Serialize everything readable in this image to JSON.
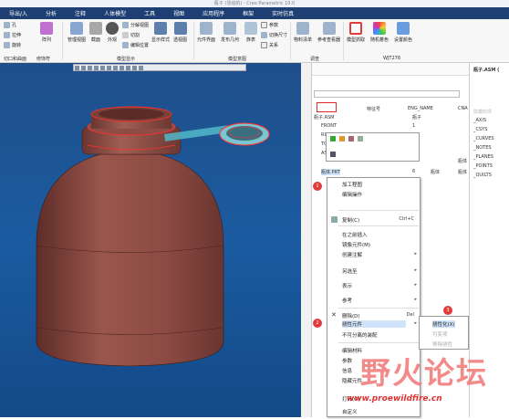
{
  "window": {
    "title": "瓶子 (活动的) - Creo Parametric 10.0"
  },
  "menu": [
    "导出/入",
    "分析",
    "注释",
    "人体模型",
    "工具",
    "视图",
    "应用程序",
    "框架",
    "实时仿真"
  ],
  "ribbon": {
    "small_left": [
      "孔",
      "拉伸",
      "旋转"
    ],
    "pattern": "阵列",
    "manage_view": "管理视图",
    "section": "截面",
    "appearance": "外观",
    "display_style": "显示样式",
    "small_mid": [
      "分解视图",
      "切割",
      "编辑位置"
    ],
    "reference": "透视图",
    "component_iface": "元件界面",
    "publish_geom": "发布几何",
    "table": "族表",
    "small_right": [
      "参数",
      "切换尺寸",
      "关系"
    ],
    "material_list": "物料清单",
    "ref_viewer": "参考查看器",
    "model_capture": "模型抓取",
    "random_color": "随机着色",
    "settings": "设置颜色",
    "groups": [
      "切口和曲面",
      "修饰符",
      "模型显示",
      "模型意图",
      "调查",
      "WJT276"
    ]
  },
  "tree": {
    "headers": [
      "特征号",
      "ENG_NAME",
      "CNA"
    ],
    "rows": [
      {
        "name": "瓶子.ASM",
        "num": "",
        "eng": "瓶子"
      },
      {
        "name": "FRONT",
        "num": "1",
        "eng": ""
      },
      {
        "name": "RIGHT",
        "num": "",
        "eng": ""
      },
      {
        "name": "TOP",
        "num": "",
        "eng": ""
      },
      {
        "name": "ASM",
        "num": "",
        "eng": ""
      },
      {
        "name": "瓶体.PRT",
        "num": "6",
        "eng": "瓶体",
        "cn": "瓶体"
      }
    ],
    "cn_col": [
      "瓶子",
      "瓶体",
      "瓶体"
    ]
  },
  "right_panel": {
    "title": "瓶子.ASM (",
    "items": [
      "隐藏的项",
      "_AXIS",
      "_CSYS",
      "_CURVES",
      "_NOTES",
      "_PLANES",
      "_POINTS",
      "_QUILTS"
    ]
  },
  "context_menu": {
    "items": [
      {
        "label": "加工程图",
        "shortcut": ""
      },
      {
        "label": "编辑操作",
        "shortcut": ""
      },
      {
        "label": "复制(C)",
        "shortcut": "Ctrl+C"
      },
      {
        "label": "在之前插入",
        "shortcut": ""
      },
      {
        "label": "镜像元件(M)",
        "shortcut": ""
      },
      {
        "label": "创建注解",
        "shortcut": ""
      },
      {
        "label": "另选至",
        "shortcut": ""
      },
      {
        "label": "表示",
        "shortcut": ""
      },
      {
        "label": "参考",
        "shortcut": ""
      },
      {
        "label": "删除(D)",
        "shortcut": "Del"
      },
      {
        "label": "挠性元件",
        "shortcut": ""
      },
      {
        "label": "不可分离的装配",
        "shortcut": ""
      },
      {
        "label": "编辑材料",
        "shortcut": ""
      },
      {
        "label": "参数",
        "shortcut": ""
      },
      {
        "label": "信息",
        "shortcut": ""
      },
      {
        "label": "隐藏元件",
        "shortcut": ""
      },
      {
        "label": "打开(O)",
        "shortcut": ""
      },
      {
        "label": "自定义",
        "shortcut": ""
      }
    ]
  },
  "submenu": {
    "items": [
      "挠性化(X)",
      "可变项",
      "移除挠性"
    ]
  },
  "badges": [
    "1",
    "2",
    "3"
  ],
  "watermark": {
    "text": "野火论坛",
    "url": "www.proewildfire.cn"
  },
  "colors": {
    "menubar": "#1d3f73",
    "viewport_bg": "#1b5ba0",
    "bottle_body": "#8b4a42",
    "badge": "#e23b3b"
  }
}
